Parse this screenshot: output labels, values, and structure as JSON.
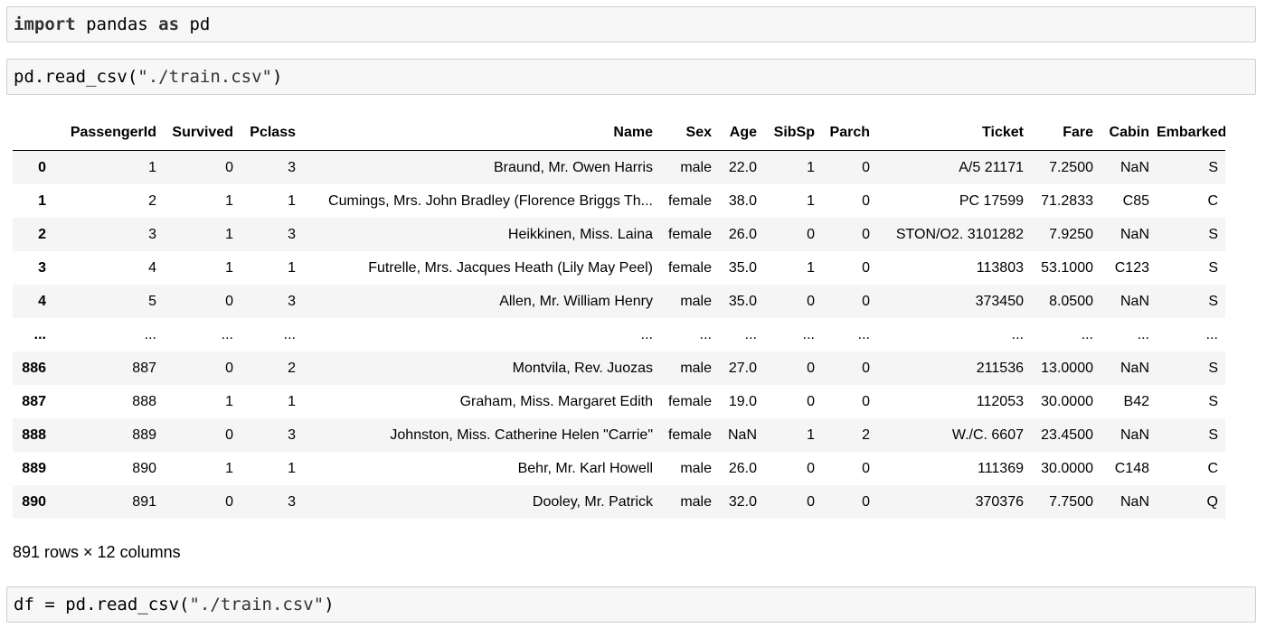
{
  "cells": [
    {
      "keyword": "import",
      "rest": " pandas ",
      "keyword2": "as",
      "rest2": " pd"
    },
    {
      "code_prefix": "pd.read_csv(",
      "string": "\"./train.csv\"",
      "code_suffix": ")"
    },
    {
      "code_prefix": "df = pd.read_csv(",
      "string": "\"./train.csv\"",
      "code_suffix": ")"
    }
  ],
  "dataframe": {
    "columns": [
      "",
      "PassengerId",
      "Survived",
      "Pclass",
      "Name",
      "Sex",
      "Age",
      "SibSp",
      "Parch",
      "Ticket",
      "Fare",
      "Cabin",
      "Embarked"
    ],
    "rows": [
      [
        "0",
        "1",
        "0",
        "3",
        "Braund, Mr. Owen Harris",
        "male",
        "22.0",
        "1",
        "0",
        "A/5 21171",
        "7.2500",
        "NaN",
        "S"
      ],
      [
        "1",
        "2",
        "1",
        "1",
        "Cumings, Mrs. John Bradley (Florence Briggs Th...",
        "female",
        "38.0",
        "1",
        "0",
        "PC 17599",
        "71.2833",
        "C85",
        "C"
      ],
      [
        "2",
        "3",
        "1",
        "3",
        "Heikkinen, Miss. Laina",
        "female",
        "26.0",
        "0",
        "0",
        "STON/O2. 3101282",
        "7.9250",
        "NaN",
        "S"
      ],
      [
        "3",
        "4",
        "1",
        "1",
        "Futrelle, Mrs. Jacques Heath (Lily May Peel)",
        "female",
        "35.0",
        "1",
        "0",
        "113803",
        "53.1000",
        "C123",
        "S"
      ],
      [
        "4",
        "5",
        "0",
        "3",
        "Allen, Mr. William Henry",
        "male",
        "35.0",
        "0",
        "0",
        "373450",
        "8.0500",
        "NaN",
        "S"
      ],
      [
        "...",
        "...",
        "...",
        "...",
        "...",
        "...",
        "...",
        "...",
        "...",
        "...",
        "...",
        "...",
        "..."
      ],
      [
        "886",
        "887",
        "0",
        "2",
        "Montvila, Rev. Juozas",
        "male",
        "27.0",
        "0",
        "0",
        "211536",
        "13.0000",
        "NaN",
        "S"
      ],
      [
        "887",
        "888",
        "1",
        "1",
        "Graham, Miss. Margaret Edith",
        "female",
        "19.0",
        "0",
        "0",
        "112053",
        "30.0000",
        "B42",
        "S"
      ],
      [
        "888",
        "889",
        "0",
        "3",
        "Johnston, Miss. Catherine Helen \"Carrie\"",
        "female",
        "NaN",
        "1",
        "2",
        "W./C. 6607",
        "23.4500",
        "NaN",
        "S"
      ],
      [
        "889",
        "890",
        "1",
        "1",
        "Behr, Mr. Karl Howell",
        "male",
        "26.0",
        "0",
        "0",
        "111369",
        "30.0000",
        "C148",
        "C"
      ],
      [
        "890",
        "891",
        "0",
        "3",
        "Dooley, Mr. Patrick",
        "male",
        "32.0",
        "0",
        "0",
        "370376",
        "7.7500",
        "NaN",
        "Q"
      ]
    ],
    "footer": "891 rows × 12 columns"
  }
}
